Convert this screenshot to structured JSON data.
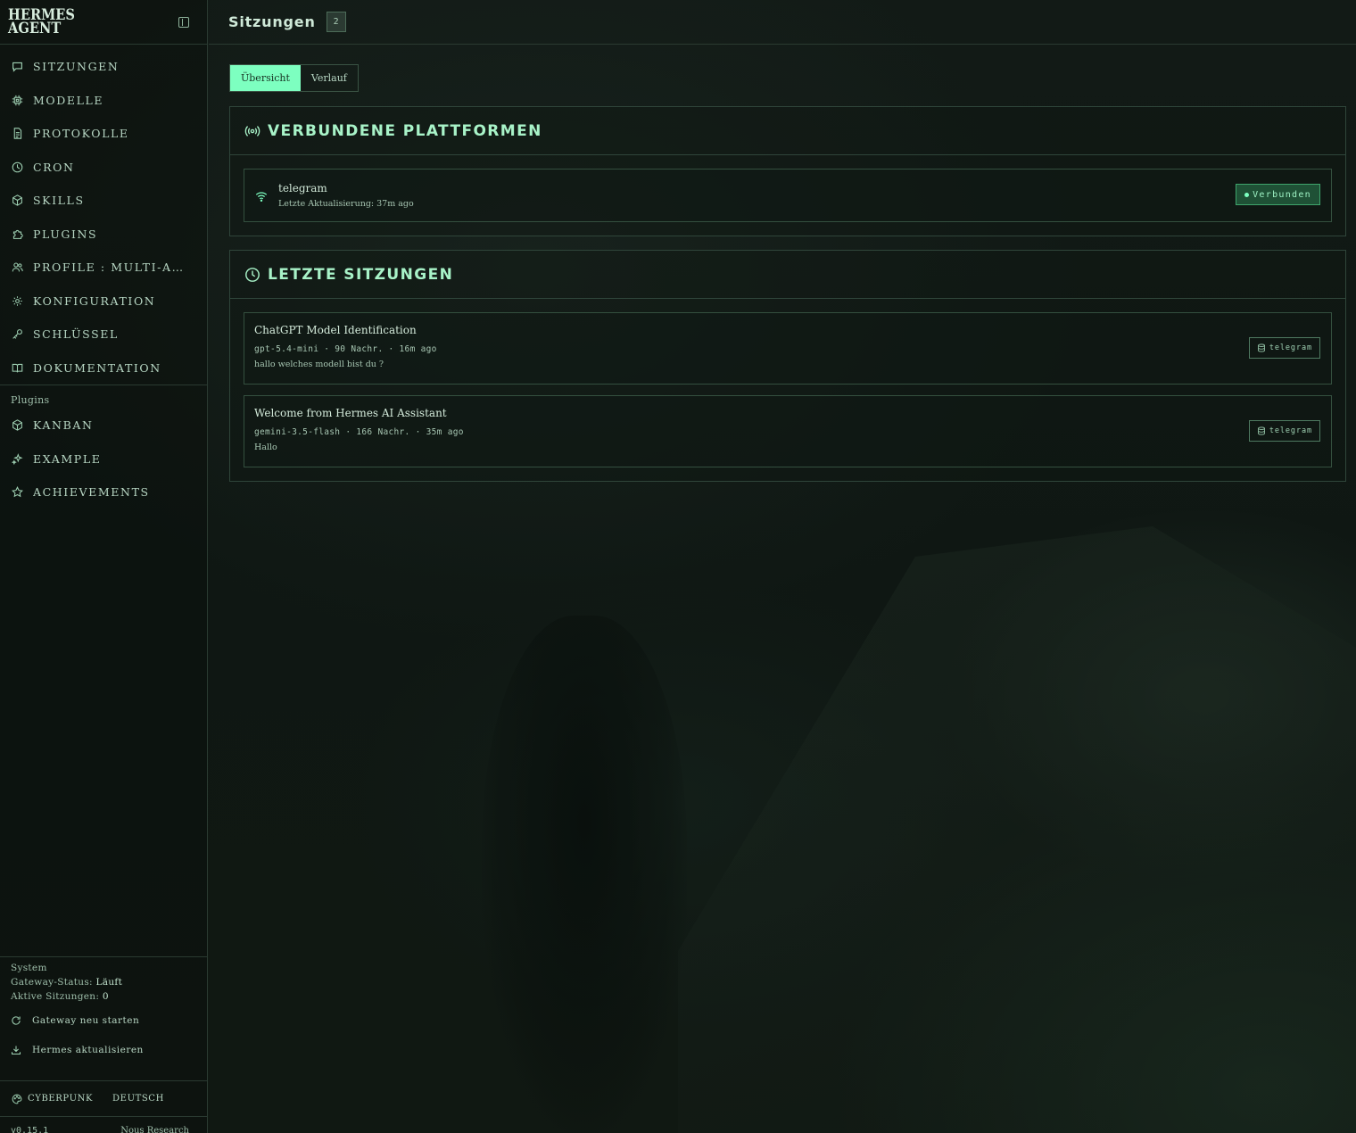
{
  "brand": {
    "line1": "HERMES",
    "line2": "AGENT"
  },
  "nav": [
    {
      "label": "SITZUNGEN",
      "icon": "chat-icon"
    },
    {
      "label": "MODELLE",
      "icon": "chip-icon"
    },
    {
      "label": "PROTOKOLLE",
      "icon": "file-icon"
    },
    {
      "label": "CRON",
      "icon": "clock-icon"
    },
    {
      "label": "SKILLS",
      "icon": "cube-icon"
    },
    {
      "label": "PLUGINS",
      "icon": "puzzle-icon"
    },
    {
      "label": "PROFILE : MULTI-AGENTEN",
      "icon": "users-icon"
    },
    {
      "label": "KONFIGURATION",
      "icon": "gear-icon"
    },
    {
      "label": "SCHLÜSSEL",
      "icon": "key-icon"
    },
    {
      "label": "DOKUMENTATION",
      "icon": "book-icon"
    }
  ],
  "plugins_section": {
    "label": "Plugins",
    "items": [
      {
        "label": "KANBAN",
        "icon": "cube-icon"
      },
      {
        "label": "EXAMPLE",
        "icon": "sparkles-icon"
      },
      {
        "label": "ACHIEVEMENTS",
        "icon": "star-icon"
      }
    ]
  },
  "system": {
    "title": "System",
    "gateway_label": "Gateway-Status:",
    "gateway_value": "Läuft",
    "sessions_label": "Aktive Sitzungen:",
    "sessions_value": "0",
    "restart_label": "Gateway neu starten",
    "update_label": "Hermes aktualisieren"
  },
  "footer": {
    "theme": "CYBERPUNK",
    "language": "DEUTSCH",
    "version": "v0.15.1",
    "credit": "Nous Research"
  },
  "header": {
    "title": "Sitzungen",
    "count": "2"
  },
  "tabs": [
    {
      "label": "Übersicht",
      "active": true
    },
    {
      "label": "Verlauf",
      "active": false
    }
  ],
  "platforms": {
    "title": "VERBUNDENE PLATTFORMEN",
    "items": [
      {
        "name": "telegram",
        "meta": "Letzte Aktualisierung: 37m ago",
        "status": "Verbunden"
      }
    ]
  },
  "recent": {
    "title": "LETZTE SITZUNGEN",
    "items": [
      {
        "title": "ChatGPT Model Identification",
        "meta": "gpt-5.4-mini · 90 Nachr. · 16m ago",
        "preview": "hallo welches modell bist du ?",
        "source": "telegram"
      },
      {
        "title": "Welcome from Hermes AI Assistant",
        "meta": "gemini-3.5-flash · 166 Nachr. · 35m ago",
        "preview": "Hallo",
        "source": "telegram"
      }
    ]
  },
  "colors": {
    "accent": "#7dffc0",
    "heading": "#a8f3c8",
    "border": "#2f453a",
    "connected_bg": "#1f5136"
  }
}
